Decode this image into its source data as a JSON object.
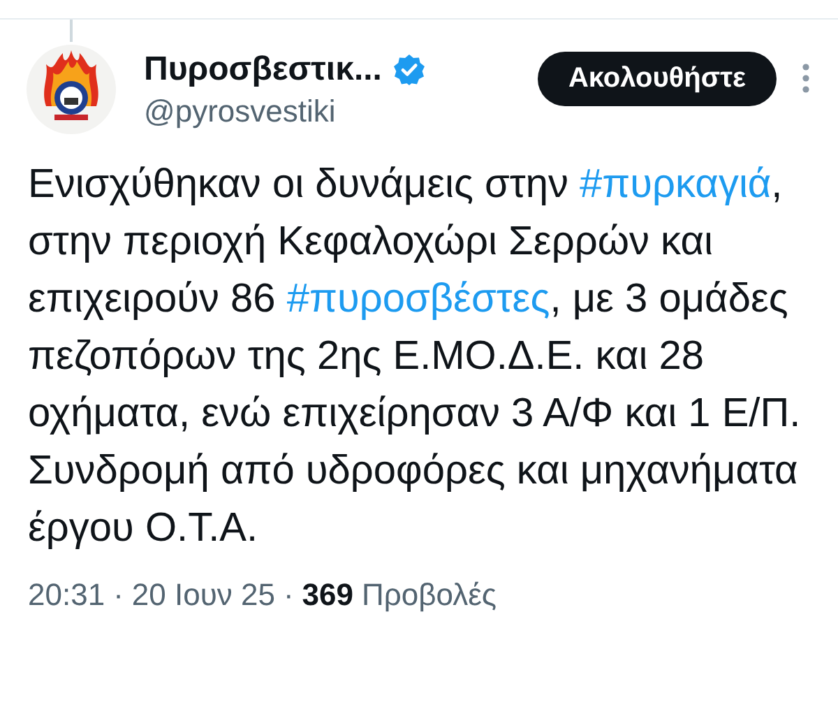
{
  "author": {
    "name": "Πυροσβεστικ...",
    "verified": true,
    "handle": "@pyrosvestiki"
  },
  "follow_button": "Ακολουθήστε",
  "body": [
    {
      "kind": "text",
      "text": "Ενισχύθηκαν οι δυνάμεις στην "
    },
    {
      "kind": "hashtag",
      "text": "#πυρκαγιά"
    },
    {
      "kind": "text",
      "text": ", στην περιοχή Κεφαλοχώρι Σερρών και επιχειρούν 86 "
    },
    {
      "kind": "hashtag",
      "text": "#πυροσβέστες"
    },
    {
      "kind": "text",
      "text": ", με 3 ομάδες πεζοπόρων της 2ης Ε.ΜΟ.Δ.Ε. και 28 οχήματα, ενώ επιχείρησαν 3 Α/Φ και 1 Ε/Π. Συνδρομή από υδροφόρες και μηχανήματα έργου Ο.Τ.Α."
    }
  ],
  "footer": [
    {
      "kind": "meta",
      "text": "20:31"
    },
    {
      "kind": "dot",
      "text": "·"
    },
    {
      "kind": "meta",
      "text": "20 Ιουν 25"
    },
    {
      "kind": "dot",
      "text": "·"
    },
    {
      "kind": "count",
      "text": "369"
    },
    {
      "kind": "meta",
      "text": "Προβολές"
    }
  ]
}
